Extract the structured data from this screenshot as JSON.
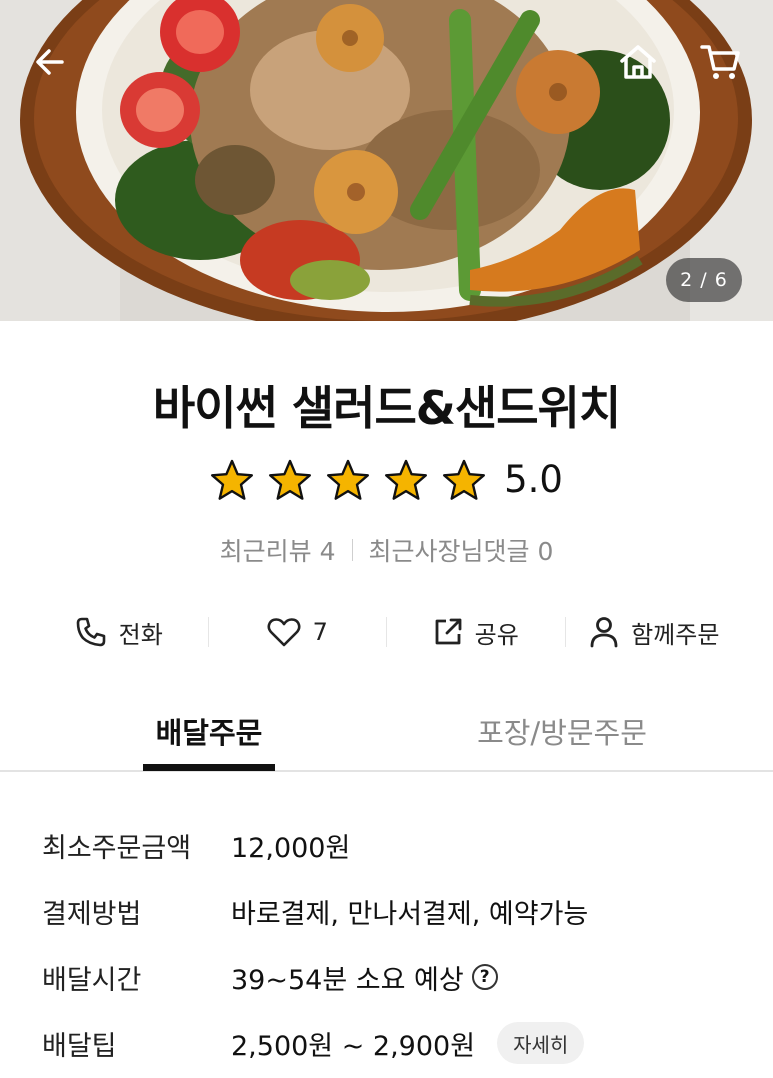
{
  "gallery": {
    "counter": "2 / 6",
    "icons": {
      "back": "arrow-left-icon",
      "home": "home-icon",
      "cart": "cart-icon"
    }
  },
  "store": {
    "name": "바이썬 샐러드&샌드위치",
    "rating": 5.0,
    "rating_text": "5.0",
    "star_color": "#F5B400",
    "recent_reviews": "최근리뷰 4",
    "owner_comments": "최근사장님댓글 0"
  },
  "actions": [
    {
      "icon": "phone-icon",
      "label": "전화"
    },
    {
      "icon": "heart-icon",
      "label": "7"
    },
    {
      "icon": "share-icon",
      "label": "공유"
    },
    {
      "icon": "person-icon",
      "label": "함께주문"
    }
  ],
  "tabs": {
    "delivery": "배달주문",
    "pickup": "포장/방문주문",
    "active": "delivery"
  },
  "info": {
    "min_order": {
      "label": "최소주문금액",
      "value": "12,000원"
    },
    "payment": {
      "label": "결제방법",
      "value": "바로결제, 만나서결제, 예약가능"
    },
    "delivery_time": {
      "label": "배달시간",
      "value": "39~54분 소요 예상",
      "help": "?"
    },
    "delivery_tip": {
      "label": "배달팁",
      "value": "2,500원 ~ 2,900원",
      "detail_button": "자세히"
    }
  }
}
